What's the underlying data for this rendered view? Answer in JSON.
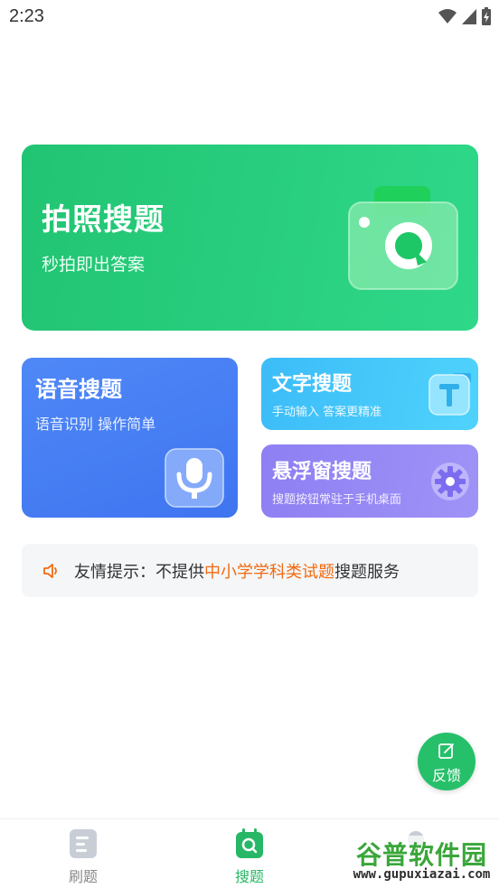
{
  "status_bar": {
    "time": "2:23",
    "icons": [
      "wifi-icon",
      "signal-icon",
      "battery-charging-icon"
    ]
  },
  "photo_search": {
    "title": "拍照搜题",
    "subtitle": "秒拍即出答案",
    "icon": "camera-icon"
  },
  "voice_search": {
    "title": "语音搜题",
    "subtitle": "语音识别 操作简单",
    "icon": "microphone-icon"
  },
  "text_search": {
    "title": "文字搜题",
    "subtitle": "手动输入 答案更精准",
    "icon": "text-t-icon"
  },
  "float_search": {
    "title": "悬浮窗搜题",
    "subtitle": "搜题按钮常驻于手机桌面",
    "icon": "gear-icon"
  },
  "tip": {
    "prefix": "友情提示：不提供",
    "highlight": "中小学学科类试题",
    "suffix": "搜题服务",
    "highlight_color": "#f26a10"
  },
  "feedback": {
    "label": "反馈",
    "icon": "edit-icon"
  },
  "bottom_nav": {
    "active": "搜题",
    "items": [
      {
        "label": "刷题",
        "icon": "document-icon"
      },
      {
        "label": "搜题",
        "icon": "search-calendar-icon"
      },
      {
        "label": "",
        "icon": "profile-icon"
      }
    ]
  },
  "watermark": {
    "title": "谷普软件园",
    "url": "www.gupuxiazai.com"
  },
  "colors": {
    "primary_green": "#27c06a",
    "voice_blue": "#4a80f4",
    "text_cyan": "#45c8fa",
    "float_purple": "#9689f5"
  }
}
